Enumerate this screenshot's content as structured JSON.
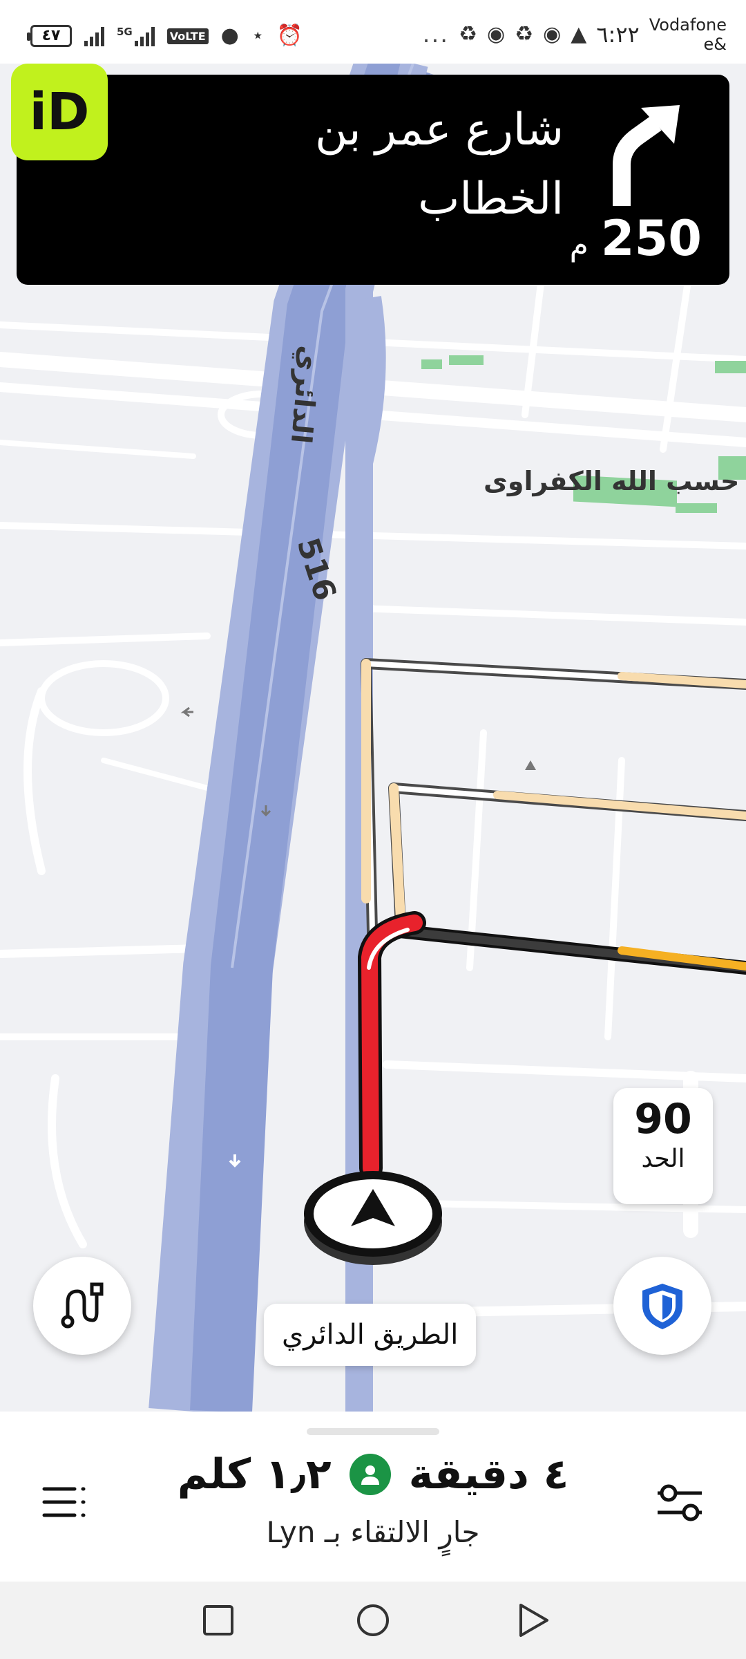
{
  "status_bar": {
    "battery": "٤٧",
    "network": "5G",
    "volte": "VoLTE",
    "time": "٦:٢٢",
    "carrier_line1": "Vodafone",
    "carrier_line2": "e&",
    "more": "..."
  },
  "app": {
    "logo_text": "iD"
  },
  "maneuver": {
    "street_line1": "شارع عمر بن",
    "street_line2": "الخطاب",
    "distance": "250",
    "unit": "م",
    "direction": "slight-right-arrow-icon"
  },
  "map": {
    "road_number": "516",
    "ring_road_label": "الدائري",
    "street_label": "ر حسب الله الكفراوى",
    "current_road": "الطريق الدائري",
    "route_color": "#e8222c",
    "highway_color": "#8e9fd4",
    "traffic_color": "#f5b023"
  },
  "speed_limit": {
    "value": "90",
    "label": "الحد"
  },
  "controls": {
    "route_button": "route-options-icon",
    "safety_button": "shield-icon"
  },
  "trip": {
    "duration": "٤ دقيقة",
    "distance": "١٫٢ كلم",
    "status": "جارٍ الالتقاء بـ Lyn"
  }
}
